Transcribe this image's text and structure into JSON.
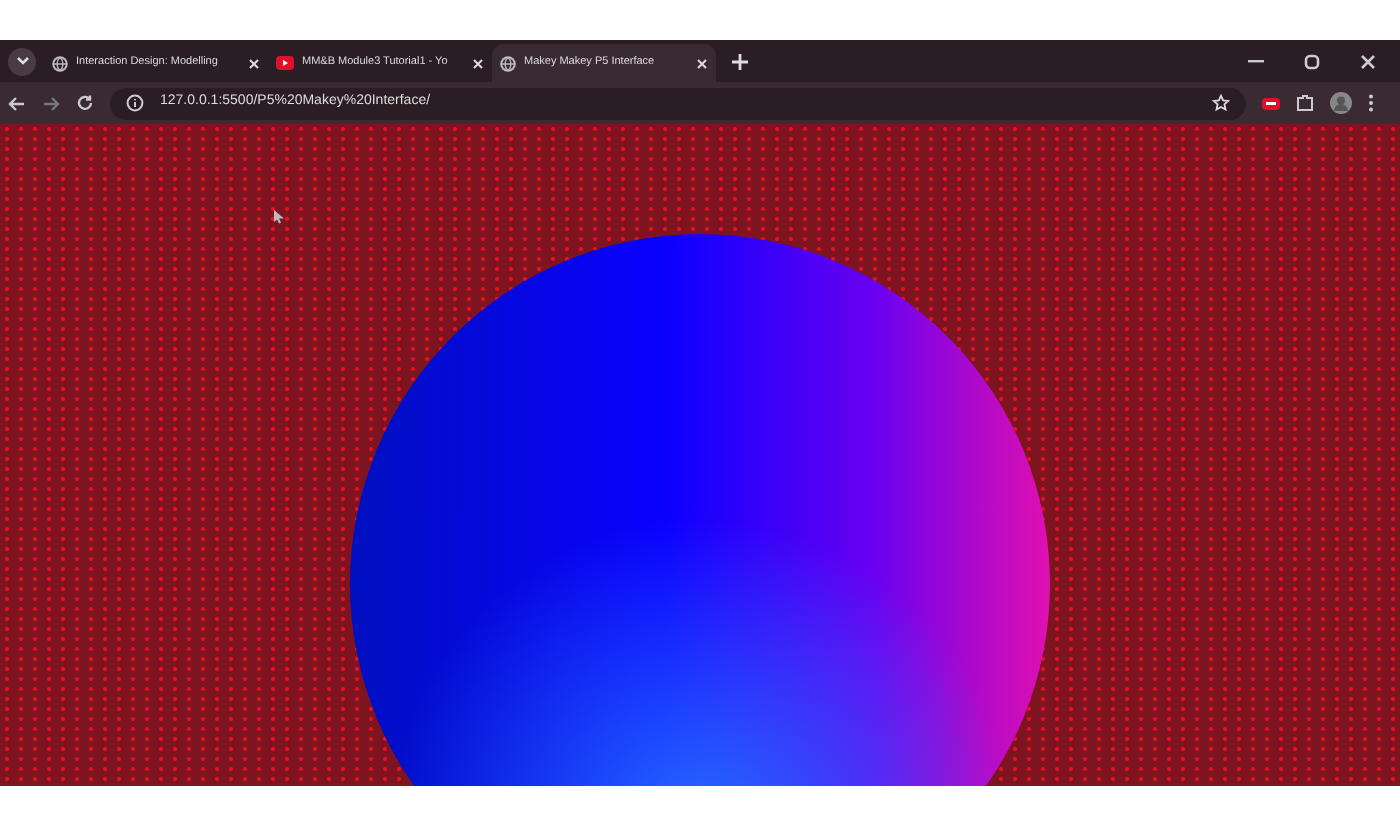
{
  "browser": {
    "tabs": [
      {
        "title": "Interaction Design: Modelling",
        "kind": "globe",
        "selected": false
      },
      {
        "title": "MM&B Module3 Tutorial1 - Yo",
        "kind": "video",
        "selected": false
      },
      {
        "title": "Makey Makey P5 Interface",
        "kind": "globe",
        "selected": true
      }
    ],
    "url": "127.0.0.1:5500/P5%20Makey%20Interface/"
  }
}
